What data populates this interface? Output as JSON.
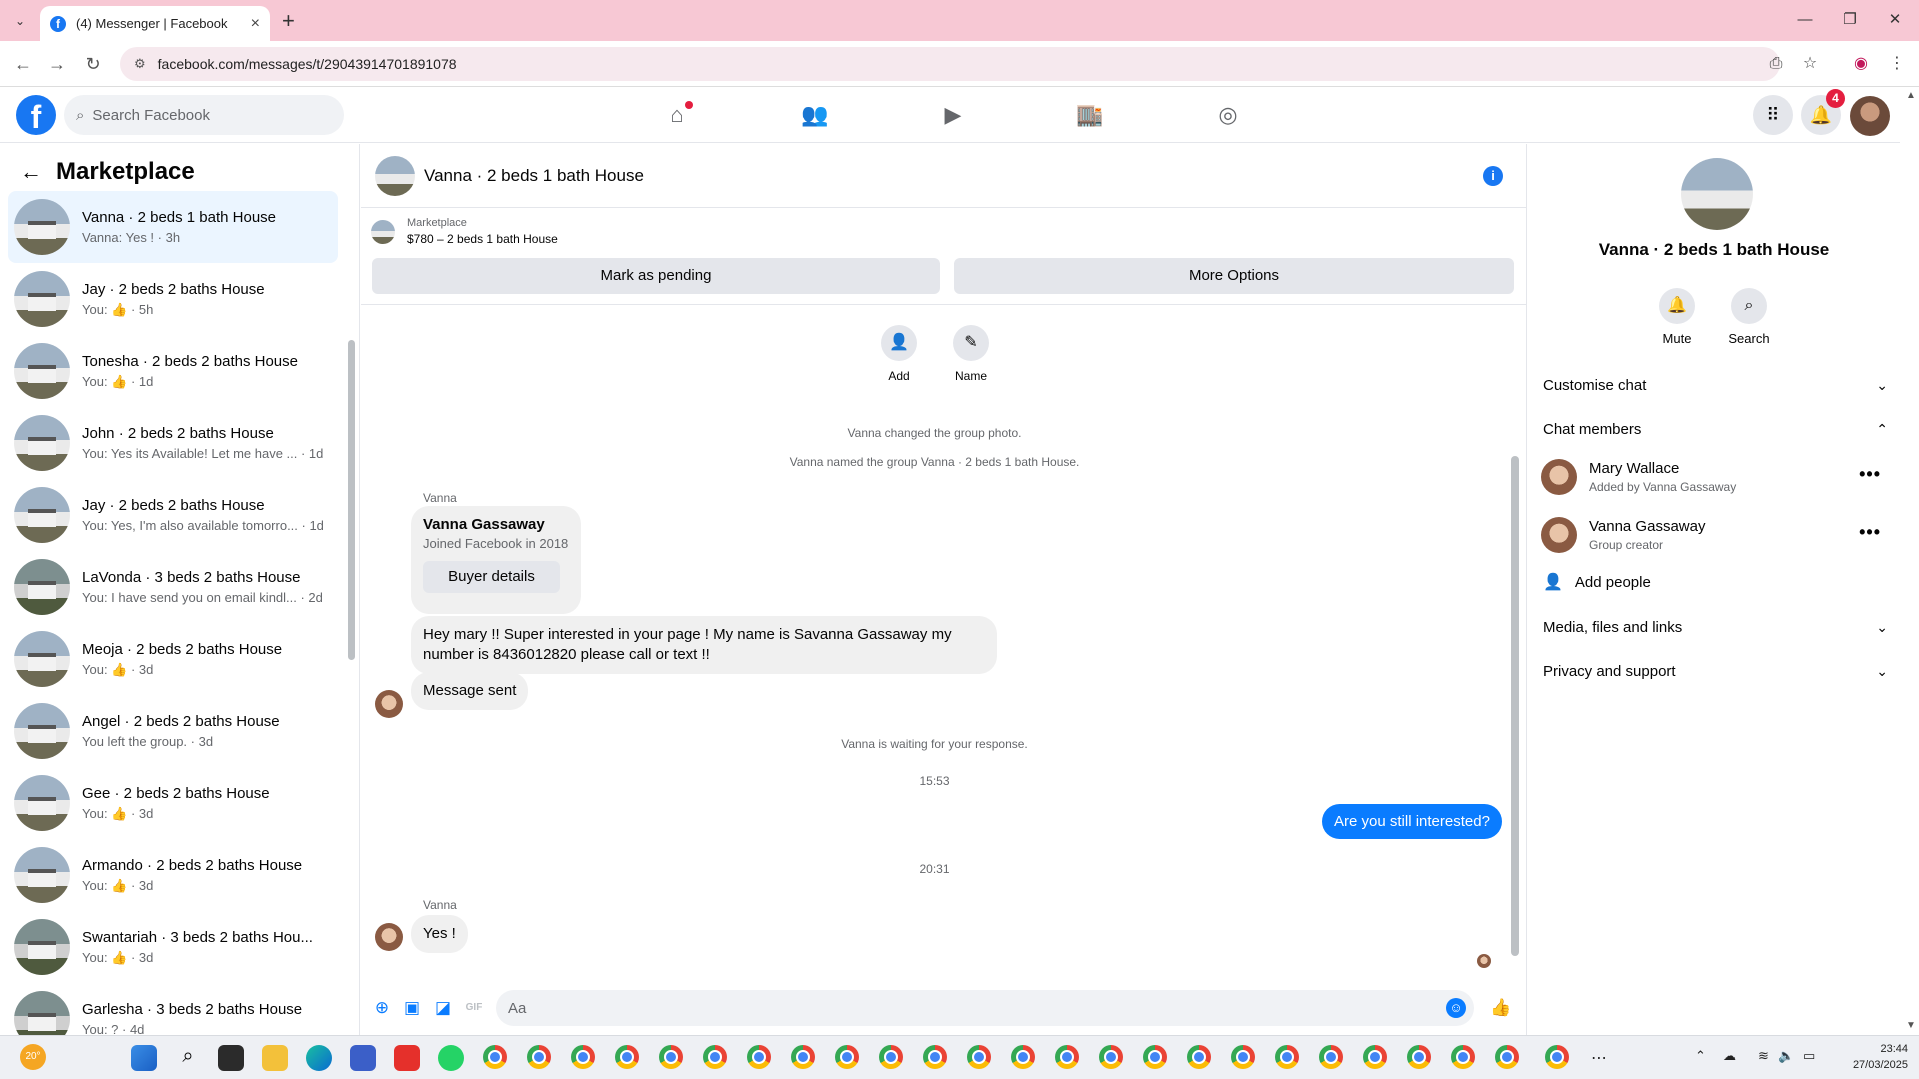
{
  "browser": {
    "tab_title": "(4) Messenger | Facebook",
    "url": "facebook.com/messages/t/29043914701891078",
    "new_tab": "+",
    "window": {
      "minimize": "—",
      "restore": "❐",
      "close": "✕"
    }
  },
  "fb_header": {
    "search_placeholder": "Search Facebook",
    "notifications_count": "4",
    "nav_icons": [
      "home-icon",
      "friends-icon",
      "video-icon",
      "marketplace-icon",
      "groups-icon"
    ],
    "accent": "#1877f2"
  },
  "left_panel": {
    "title": "Marketplace",
    "conversations": [
      {
        "name": "Vanna · 2 beds 1 bath House",
        "sub": "Vanna: Yes ! · 3h",
        "active": true
      },
      {
        "name": "Jay · 2 beds 2 baths House",
        "sub_prefix": "You: ",
        "sub_suffix": " · 5h"
      },
      {
        "name": "Tonesha · 2 beds 2 baths House",
        "sub_prefix": "You: ",
        "sub_suffix": " · 1d"
      },
      {
        "name": "John · 2 beds 2 baths House",
        "sub": "You: Yes its Available! Let me have ...  · 1d"
      },
      {
        "name": "Jay · 2 beds 2 baths House",
        "sub": "You: Yes, I'm also available tomorro...  · 1d"
      },
      {
        "name": "LaVonda · 3 beds 2 baths House",
        "sub": "You: I have send you on email kindl... · 2d"
      },
      {
        "name": "Meoja · 2 beds 2 baths House",
        "sub_prefix": "You: ",
        "sub_suffix": " · 3d"
      },
      {
        "name": "Angel · 2 beds 2 baths House",
        "sub": "You left the group. · 3d"
      },
      {
        "name": "Gee · 2 beds 2 baths House",
        "sub_prefix": "You: ",
        "sub_suffix": " · 3d"
      },
      {
        "name": "Armando · 2 beds 2 baths House",
        "sub_prefix": "You: ",
        "sub_suffix": " · 3d"
      },
      {
        "name": "Swantariah · 3 beds 2 baths Hou...",
        "sub_prefix": "You: ",
        "sub_suffix": " · 3d"
      },
      {
        "name": "Garlesha · 3 beds 2 baths House",
        "sub": "You: ? · 4d"
      }
    ]
  },
  "chat": {
    "title": "Vanna · 2 beds 1 bath House",
    "marketplace_label": "Marketplace",
    "listing": "$780 – 2 beds 1 bath House",
    "mark_pending": "Mark as pending",
    "more_options": "More Options",
    "actions": {
      "add": "Add",
      "name": "Name"
    },
    "system_1": "Vanna changed the group photo.",
    "system_2": "Vanna named the group Vanna · 2 beds 1 bath House.",
    "sender_1": "Vanna",
    "card_name": "Vanna Gassaway",
    "card_sub": "Joined Facebook in 2018",
    "card_button": "Buyer details",
    "msg_1_line1": "Hey mary !! Super interested in your page ! My name is Savanna Gassaway my",
    "msg_1_line2": "number is 8436012820 please call or text !!",
    "msg_2": "Message sent",
    "system_3": "Vanna is waiting for your response.",
    "time_1": "15:53",
    "msg_out": "Are you still interested?",
    "time_2": "20:31",
    "sender_2": "Vanna",
    "msg_3": "Yes !",
    "composer_placeholder": "Aa",
    "gif_label": "GIF"
  },
  "right_panel": {
    "name": "Vanna · 2 beds 1 bath House",
    "mute": "Mute",
    "search": "Search",
    "customise": "Customise chat",
    "chat_members": "Chat members",
    "members": [
      {
        "name": "Mary Wallace",
        "sub": "Added by Vanna Gassaway"
      },
      {
        "name": "Vanna Gassaway",
        "sub": "Group creator"
      }
    ],
    "add_people": "Add people",
    "media": "Media, files and links",
    "privacy": "Privacy and support"
  },
  "taskbar": {
    "weather": "20°",
    "time": "23:44",
    "date": "27/03/2025"
  }
}
